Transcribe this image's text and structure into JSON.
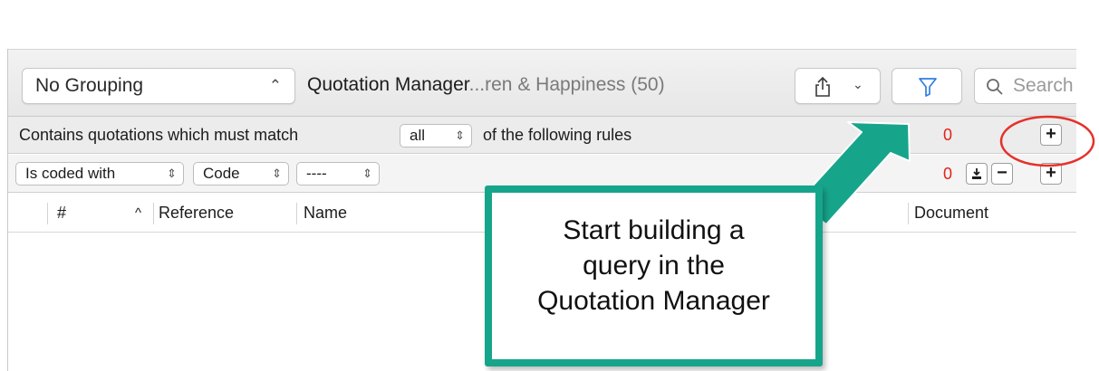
{
  "toolbar": {
    "grouping_value": "No Grouping",
    "title_main": "Quotation Manager",
    "title_sub": "...ren & Happiness (50)",
    "search_placeholder": "Search"
  },
  "filter": {
    "prefix": "Contains quotations which must match",
    "match_mode": "all",
    "suffix": "of the following rules",
    "count": "0"
  },
  "rule": {
    "condition": "Is coded with",
    "type": "Code",
    "value": "----",
    "count": "0"
  },
  "table": {
    "columns": [
      "#",
      "Reference",
      "Name",
      "Document"
    ],
    "sort_indicator": "^"
  },
  "callout": {
    "lines": [
      "Start building a",
      "query in the",
      "Quotation Manager"
    ]
  },
  "colors": {
    "accent_teal": "#16a58b",
    "highlight_red": "#e4312a",
    "count_red": "#e32119",
    "filter_blue": "#2f7fe0"
  }
}
